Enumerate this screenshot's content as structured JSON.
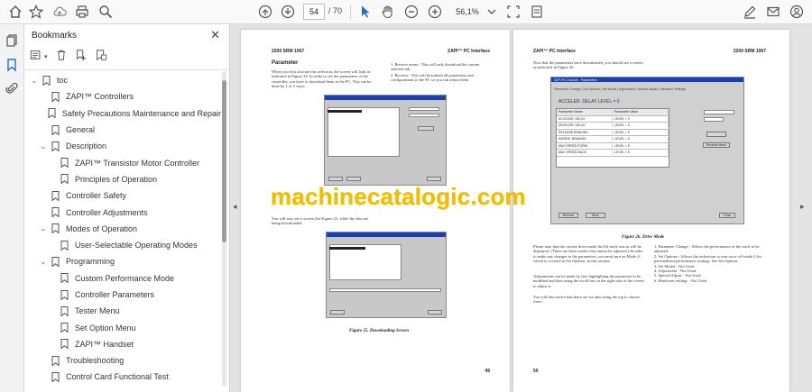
{
  "toolbar": {
    "current_page": "54",
    "total_pages": "/ 70",
    "zoom": "56,1%"
  },
  "bookmarks": {
    "title": "Bookmarks",
    "items": [
      {
        "label": "toc",
        "level": 0,
        "chevron": "down"
      },
      {
        "label": "ZAPI™ Controllers",
        "level": 1,
        "chevron": ""
      },
      {
        "label": "Safety Precautions Maintenance and Repair",
        "level": 1,
        "chevron": ""
      },
      {
        "label": "General",
        "level": 1,
        "chevron": ""
      },
      {
        "label": "Description",
        "level": 1,
        "chevron": "down"
      },
      {
        "label": "ZAPI™ Transistor Motor Controller",
        "level": 2,
        "chevron": ""
      },
      {
        "label": "Principles of Operation",
        "level": 2,
        "chevron": ""
      },
      {
        "label": "Controller Safety",
        "level": 1,
        "chevron": ""
      },
      {
        "label": "Controller Adjustments",
        "level": 1,
        "chevron": ""
      },
      {
        "label": "Modes of Operation",
        "level": 1,
        "chevron": "down"
      },
      {
        "label": "User-Selectable Operating Modes",
        "level": 2,
        "chevron": ""
      },
      {
        "label": "Programming",
        "level": 1,
        "chevron": "down"
      },
      {
        "label": "Custom Performance Mode",
        "level": 2,
        "chevron": ""
      },
      {
        "label": "Controller Parameters",
        "level": 2,
        "chevron": ""
      },
      {
        "label": "Tester Menu",
        "level": 2,
        "chevron": ""
      },
      {
        "label": "Set Option Menu",
        "level": 2,
        "chevron": ""
      },
      {
        "label": "ZAPI™ Handset",
        "level": 2,
        "chevron": ""
      },
      {
        "label": "Troubleshooting",
        "level": 1,
        "chevron": ""
      },
      {
        "label": "Control Card Functional Test",
        "level": 1,
        "chevron": ""
      }
    ]
  },
  "left_page": {
    "header_left": "2200 SRM 1067",
    "header_right": "ZAPI™ PC Interface",
    "section": "Parameter",
    "para1": "When you first activate this selection, the screen will look as indicated in Figure 24. In order to see the parameters of the controller, you have to download them to the PC. This can be done by 1 of 2 ways:",
    "list1": "1.  Receive menu - This will only download the current selected tab.",
    "list2": "2.  Receive - This will download all parameters and configurations to the PC so you can adjust them.",
    "para2": "You will now see a screen like Figure 25, while the data are being downloaded.",
    "caption": "Figure 25. Downloading Screen",
    "page_number": "49"
  },
  "right_page": {
    "header_left": "ZAPI™ PC Interface",
    "header_right": "2200 SRM 1067",
    "para1": "Now that the parameters have downloaded, you should see a screen as indicated in Figure 26.",
    "window_title": "ZAPI Pc Console - Parameters",
    "tabs": "Parameter Change | Set Options | Set Model | Adjustment | Special Adjust | Hardware Settings",
    "accel": "ACCELER. DELAY        LEVEL = 0",
    "table_head": [
      "Parameter Name",
      "Parameter Value"
    ],
    "rows": [
      [
        "ACCELER. DELAY",
        "LEVEL = 0"
      ],
      [
        "DECELER. DELAY",
        "LEVEL = 5"
      ],
      [
        "RELEASE BRAKING",
        "LEVEL = 5"
      ],
      [
        "INVERS. BRAKING",
        "LEVEL = 5"
      ],
      [
        "MAX SPEED FORW.",
        "LEVEL = 5"
      ],
      [
        "MAX SPEED BACK",
        "LEVEL = 5"
      ]
    ],
    "btn_receive_menu": "Receive Menu",
    "btn_receive": "Receive",
    "btn_store": "Store",
    "btn_close": "Close",
    "caption": "Figure 26. Drive Mode",
    "para2": "Please note that the current drive mode the lift truck was in will be displayed. (There are three modes that cannot be adjusted.) In order to make any changes to the parameters, you must turn on Mode 4, which is covered in Set Options, in this section.",
    "para3": "Adjustments can be made by first highlighting the parameter to be modified and then using the scroll bar on the right side of the screen to adjust it.",
    "para4": "You will also notice that there are six tabs along the top to choose from:",
    "list": [
      "1.  Parameter Change - Allows the performance of the truck to be adjusted.",
      "2.  Set Options - Allows the technician to turn on or off mode 4 for personalized performance settings. See Set Options.",
      "3.  Set Model - Not Used.",
      "4.  Adjustment - Not Used.",
      "5.  Special Adjust - Not Used.",
      "6.  Hardware settings - Not Used."
    ],
    "page_number": "50"
  },
  "watermark": "machinecatalogic.com"
}
